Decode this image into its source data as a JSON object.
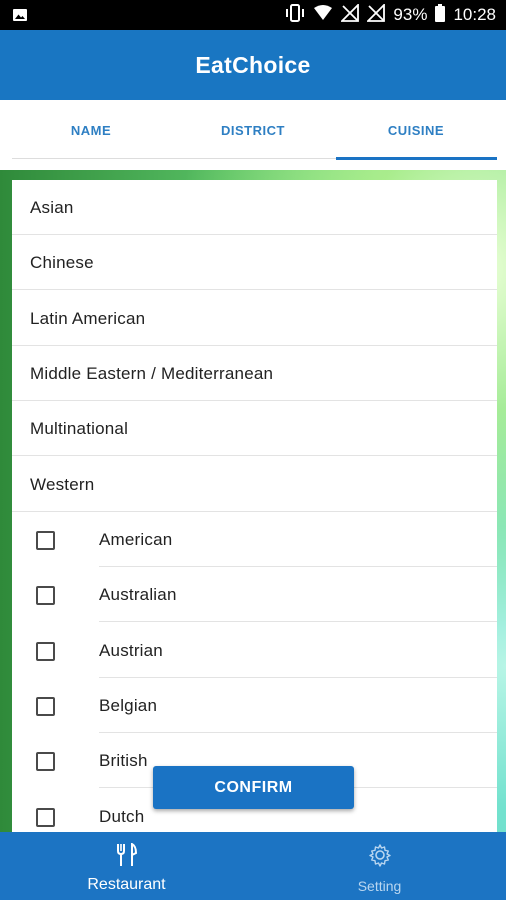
{
  "status_bar": {
    "battery": "93%",
    "time": "10:28",
    "icons": [
      "image-icon",
      "vibrate-icon",
      "wifi-icon",
      "no-signal-icon",
      "no-signal-icon",
      "battery-icon"
    ]
  },
  "app_bar": {
    "title": "EatChoice"
  },
  "tabs": [
    {
      "label": "NAME"
    },
    {
      "label": "DISTRICT"
    },
    {
      "label": "CUISINE",
      "selected": true
    }
  ],
  "categories": [
    {
      "label": "Asian"
    },
    {
      "label": "Chinese"
    },
    {
      "label": "Latin American"
    },
    {
      "label": "Middle Eastern / Mediterranean"
    },
    {
      "label": "Multinational"
    },
    {
      "label": "Western"
    }
  ],
  "options": [
    {
      "label": "American",
      "checked": false
    },
    {
      "label": "Australian",
      "checked": false
    },
    {
      "label": "Austrian",
      "checked": false
    },
    {
      "label": "Belgian",
      "checked": false
    },
    {
      "label": "British",
      "checked": false
    },
    {
      "label": "Dutch",
      "checked": false
    }
  ],
  "confirm": {
    "label": "CONFIRM"
  },
  "bottom_nav": [
    {
      "label": "Restaurant",
      "icon": "fork-knife-icon",
      "active": true
    },
    {
      "label": "Setting",
      "icon": "gear-icon",
      "active": false
    }
  ],
  "colors": {
    "primary": "#1976c2",
    "tab_text": "#2e7fc3",
    "nav_inactive": "#b9d6f0"
  }
}
